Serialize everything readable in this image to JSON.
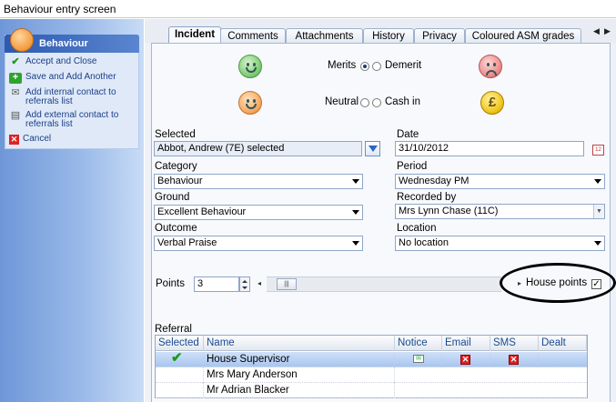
{
  "window": {
    "title": "Behaviour entry screen"
  },
  "sidebar": {
    "header": "Behaviour",
    "items": [
      {
        "label": "Accept and Close",
        "icon": "check-icon"
      },
      {
        "label": "Save and Add Another",
        "icon": "plus-icon"
      },
      {
        "label": "Add internal contact to referrals list",
        "icon": "envelope-icon"
      },
      {
        "label": "Add external contact to referrals list",
        "icon": "printer-icon"
      },
      {
        "label": "Cancel",
        "icon": "close-icon"
      }
    ]
  },
  "tabs": [
    {
      "label": "Incident",
      "active": true
    },
    {
      "label": "Comments",
      "active": false
    },
    {
      "label": "Attachments",
      "active": false
    },
    {
      "label": "History",
      "active": false
    },
    {
      "label": "Privacy",
      "active": false
    },
    {
      "label": "Coloured ASM grades",
      "active": false
    }
  ],
  "type_options": {
    "merits": "Merits",
    "demerit": "Demerit",
    "neutral": "Neutral",
    "cash_in": "Cash in",
    "selected": "Merits",
    "cash_symbol": "£"
  },
  "form": {
    "selected_label": "Selected",
    "selected_value": "Abbot, Andrew (7E)   selected",
    "date_label": "Date",
    "date_value": "31/10/2012",
    "category_label": "Category",
    "category_value": "Behaviour",
    "period_label": "Period",
    "period_value": "Wednesday PM",
    "ground_label": "Ground",
    "ground_value": "Excellent Behaviour",
    "recorded_by_label": "Recorded by",
    "recorded_by_value": "Mrs Lynn Chase (11C)",
    "outcome_label": "Outcome",
    "outcome_value": "Verbal Praise",
    "location_label": "Location",
    "location_value": "No location",
    "points_label": "Points",
    "points_value": "3",
    "house_points_label": "House points",
    "house_points_checked": true,
    "calendar_text": "12"
  },
  "referral": {
    "title": "Referral",
    "columns": [
      "Selected",
      "Name",
      "Notice",
      "Email",
      "SMS",
      "Dealt"
    ],
    "rows": [
      {
        "selected": true,
        "name": "House Supervisor",
        "notice": true,
        "email": false,
        "sms": false
      },
      {
        "selected": false,
        "name": "Mrs Mary Anderson"
      },
      {
        "selected": false,
        "name": "Mr Adrian Blacker"
      }
    ]
  },
  "colors": {
    "accent": "#2d59b0",
    "selection": "#a9c6ef",
    "sidebar": "#98b8e8"
  }
}
